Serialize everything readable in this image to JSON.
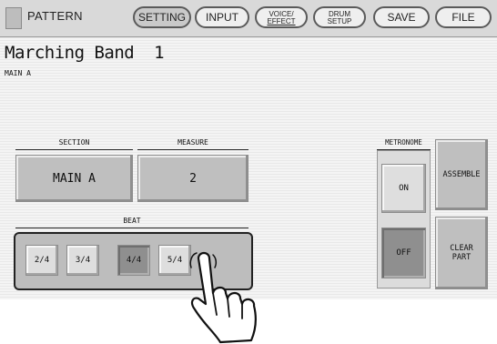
{
  "header": {
    "mode_label": "PATTERN",
    "tabs": [
      {
        "line1": "SETTING",
        "line2": "",
        "active": true
      },
      {
        "line1": "INPUT",
        "line2": "",
        "active": false
      },
      {
        "line1": "VOICE/",
        "line2": "EFFECT",
        "active": false
      },
      {
        "line1": "DRUM",
        "line2": "SETUP",
        "active": false
      },
      {
        "line1": "SAVE",
        "line2": "",
        "active": false
      },
      {
        "line1": "FILE",
        "line2": "",
        "active": false
      }
    ]
  },
  "main": {
    "pattern_name": "Marching Band  1",
    "section_subtitle": "MAIN A"
  },
  "section": {
    "header": "SECTION",
    "value": "MAIN A"
  },
  "measure": {
    "header": "MEASURE",
    "value": "2"
  },
  "beat": {
    "header": "BEAT",
    "options": [
      "2/4",
      "3/4",
      "4/4",
      "5/4"
    ],
    "selected": "4/4"
  },
  "metronome": {
    "header": "METRONOME",
    "on_label": "ON",
    "off_label": "OFF",
    "selected": "OFF"
  },
  "side_buttons": {
    "assemble": "ASSEMBLE",
    "clear_line1": "CLEAR",
    "clear_line2": "PART"
  },
  "icons": {
    "pointer": "pointing-hand-icon"
  }
}
